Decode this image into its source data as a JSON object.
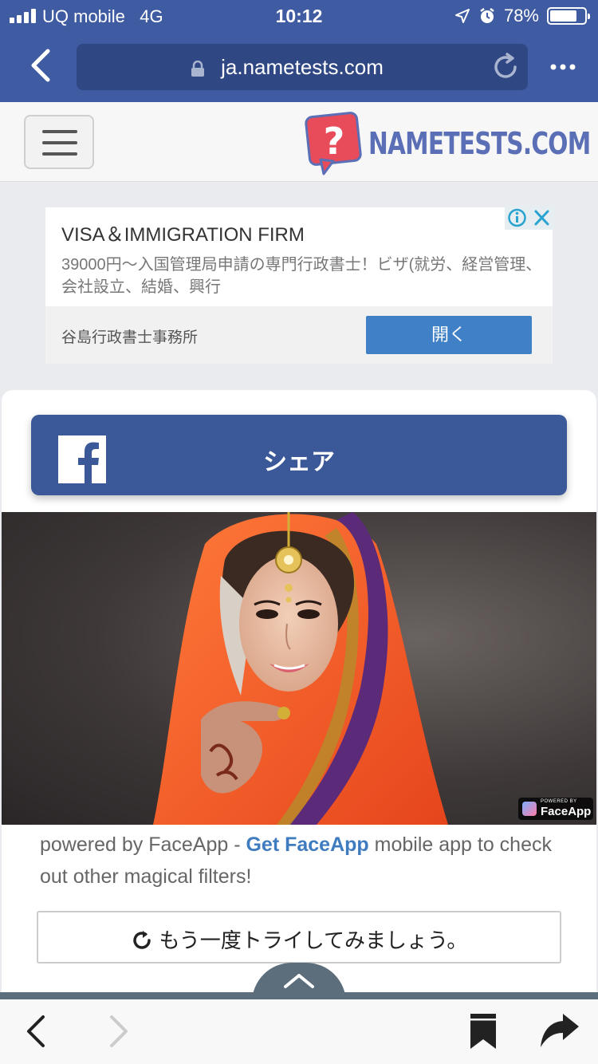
{
  "status_bar": {
    "carrier": "UQ mobile",
    "network": "4G",
    "time": "10:12",
    "battery_percent": "78%",
    "battery_level": 0.78
  },
  "browser": {
    "url": "ja.nametests.com"
  },
  "site": {
    "logo_text": "NAMETESTS.COM",
    "logo_glyph": "?"
  },
  "ad": {
    "title": "VISA＆IMMIGRATION FIRM",
    "description": "39000円～入国管理局申請の専門行政書士！ビザ(就労、経営管理、会社設立、結婚、興行",
    "advertiser": "谷島行政書士事務所",
    "cta": "開く"
  },
  "card": {
    "share_label": "シェア",
    "photo_badge_small": "POWERED BY",
    "photo_badge_big": "FaceApp",
    "powered_prefix": "powered by FaceApp - ",
    "powered_link": "Get FaceApp",
    "powered_suffix": " mobile app to check out other magical filters!",
    "retry_label": "もう一度トライしてみましょう。"
  },
  "colors": {
    "browser_blue": "#3f5ba1",
    "facebook_blue": "#3b5998",
    "link_blue": "#3f7cbf",
    "logo_red": "#e84c5a"
  }
}
